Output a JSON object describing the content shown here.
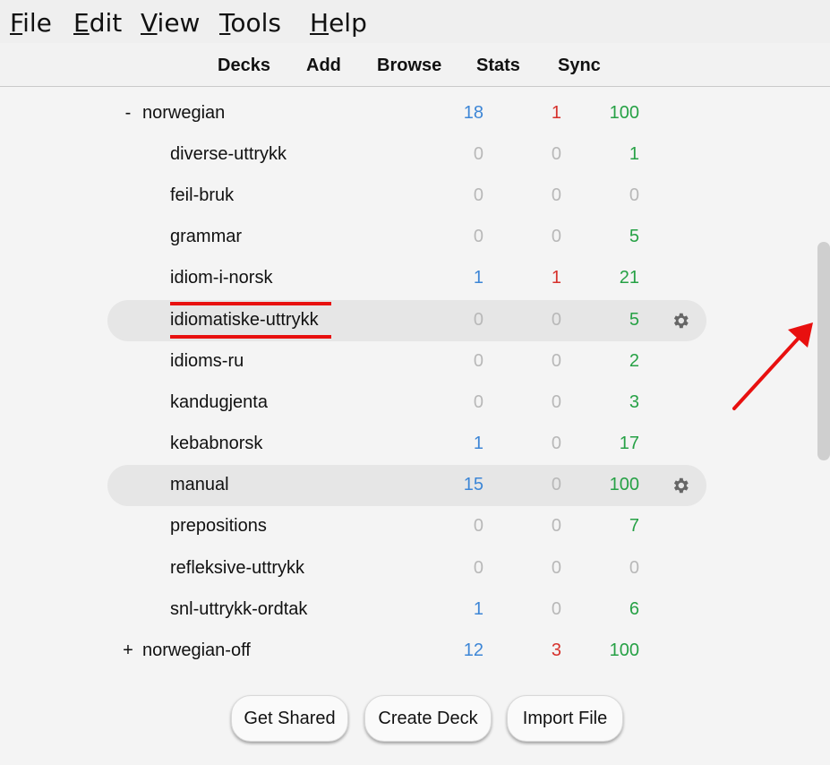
{
  "menu": {
    "items": [
      {
        "mnemonic": "F",
        "rest": "ile"
      },
      {
        "mnemonic": "E",
        "rest": "dit"
      },
      {
        "mnemonic": "V",
        "rest": "iew"
      },
      {
        "mnemonic": "T",
        "rest": "ools"
      },
      {
        "mnemonic": "H",
        "rest": "elp"
      }
    ]
  },
  "toolbar": {
    "decks": "Decks",
    "add": "Add",
    "browse": "Browse",
    "stats": "Stats",
    "sync": "Sync"
  },
  "decks": [
    {
      "toggle": "-",
      "name": "norwegian",
      "new": "18",
      "learn": "1",
      "due": "100"
    },
    {
      "name": "diverse-uttrykk",
      "new": "0",
      "learn": "0",
      "due": "1"
    },
    {
      "name": "feil-bruk",
      "new": "0",
      "learn": "0",
      "due": "0"
    },
    {
      "name": "grammar",
      "new": "0",
      "learn": "0",
      "due": "5"
    },
    {
      "name": "idiom-i-norsk",
      "new": "1",
      "learn": "1",
      "due": "21"
    },
    {
      "name": "idiomatiske-uttrykk",
      "new": "0",
      "learn": "0",
      "due": "5"
    },
    {
      "name": "idioms-ru",
      "new": "0",
      "learn": "0",
      "due": "2"
    },
    {
      "name": "kandugjenta",
      "new": "0",
      "learn": "0",
      "due": "3"
    },
    {
      "name": "kebabnorsk",
      "new": "1",
      "learn": "0",
      "due": "17"
    },
    {
      "name": "manual",
      "new": "15",
      "learn": "0",
      "due": "100"
    },
    {
      "name": "prepositions",
      "new": "0",
      "learn": "0",
      "due": "7"
    },
    {
      "name": "refleksive-uttrykk",
      "new": "0",
      "learn": "0",
      "due": "0"
    },
    {
      "name": "snl-uttrykk-ordtak",
      "new": "1",
      "learn": "0",
      "due": "6"
    },
    {
      "toggle": "+",
      "name": "norwegian-off",
      "new": "12",
      "learn": "3",
      "due": "100"
    }
  ],
  "buttons": {
    "get_shared": "Get Shared",
    "create_deck": "Create Deck",
    "import_file": "Import File"
  },
  "colors": {
    "new": "#3d86d6",
    "learn": "#d6312c",
    "due": "#26a145",
    "zero": "#b8b8b8",
    "annotation": "#e8100f"
  }
}
